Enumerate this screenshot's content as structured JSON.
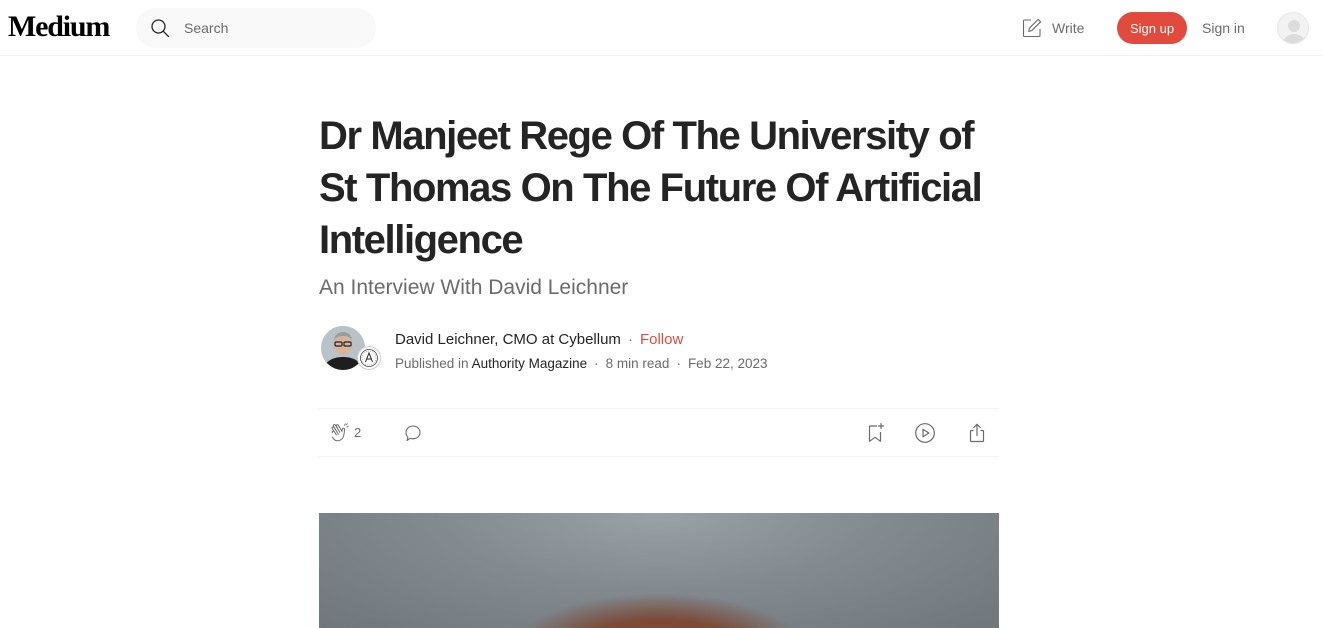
{
  "header": {
    "logo": "Medium",
    "search": {
      "placeholder": "Search",
      "icon": "search-icon"
    },
    "write_label": "Write",
    "signup_label": "Sign up",
    "signin_label": "Sign in",
    "accent_color": "#e24a3d"
  },
  "article": {
    "title": "Dr Manjeet Rege Of The University of St Thomas On The Future Of Artificial Intelligence",
    "subtitle": "An Interview With David Leichner",
    "author": {
      "name": "David Leichner, CMO at Cybellum",
      "follow_label": "Follow"
    },
    "meta": {
      "published_in_label": "Published in",
      "publication": "Authority Magazine",
      "read_time": "8 min read",
      "date": "Feb 22, 2023"
    },
    "actions": {
      "clap_count": "2",
      "icons": [
        "clap-icon",
        "comment-icon",
        "bookmark-icon",
        "play-icon",
        "share-icon"
      ]
    }
  }
}
